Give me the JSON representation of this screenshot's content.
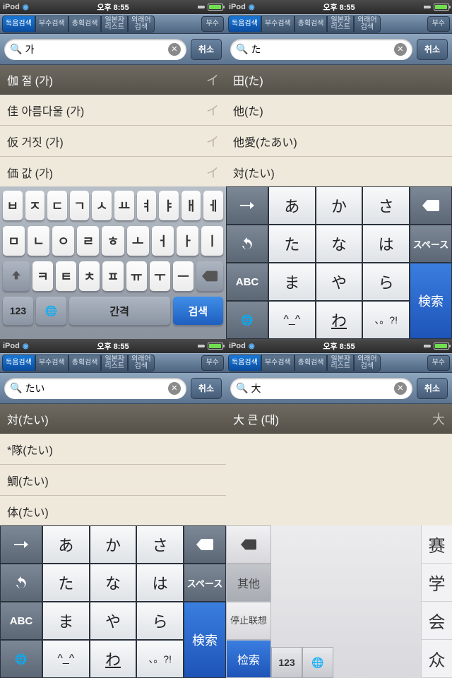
{
  "status": {
    "carrier": "iPod",
    "time": "오후 8:55"
  },
  "tabs": {
    "items": [
      "독음검색",
      "부수검색",
      "총획검색",
      "일본자\n리스트",
      "외래어\n검색"
    ],
    "extra": "부수"
  },
  "cancel": "취소",
  "screens": {
    "tl": {
      "query": "가",
      "header": {
        "text": "伽 절 (가)",
        "tail": "イ"
      },
      "rows": [
        {
          "text": "佳 아름다울 (가)",
          "tail": "イ"
        },
        {
          "text": "仮 거짓 (가)",
          "tail": "イ"
        },
        {
          "text": "価 값 (가)",
          "tail": "イ"
        }
      ]
    },
    "tr": {
      "query": "た",
      "header": {
        "text": "田(た)",
        "tail": ""
      },
      "rows": [
        {
          "text": "他(た)"
        },
        {
          "text": "他愛(たあい)"
        },
        {
          "text": "対(たい)"
        }
      ]
    },
    "bl": {
      "query": "たい",
      "header": {
        "text": "対(たい)",
        "tail": ""
      },
      "rows": [
        {
          "text": "*隊(たい)"
        },
        {
          "text": "鯛(たい)"
        },
        {
          "text": "体(たい)"
        }
      ]
    },
    "br": {
      "query": "大",
      "header": {
        "text": "大 큰 (대)",
        "tail": "大"
      },
      "rows": []
    }
  },
  "kb_ko": {
    "r1": [
      "ㅂ",
      "ㅈ",
      "ㄷ",
      "ㄱ",
      "ㅅ",
      "ㅛ",
      "ㅕ",
      "ㅑ",
      "ㅐ",
      "ㅔ"
    ],
    "r2": [
      "ㅁ",
      "ㄴ",
      "ㅇ",
      "ㄹ",
      "ㅎ",
      "ㅗ",
      "ㅓ",
      "ㅏ",
      "ㅣ"
    ],
    "r3": [
      "ㅋ",
      "ㅌ",
      "ㅊ",
      "ㅍ",
      "ㅠ",
      "ㅜ",
      "ㅡ"
    ],
    "num": "123",
    "space": "간격",
    "search": "검색"
  },
  "kb_jp": {
    "grid": [
      [
        "→",
        "あ",
        "か",
        "さ",
        "⌫"
      ],
      [
        "↺",
        "た",
        "な",
        "は",
        "スペース"
      ],
      [
        "ABC",
        "ま",
        "や",
        "ら",
        "検索"
      ],
      [
        "🌐",
        "゛゜",
        "わ",
        "、。?!",
        ""
      ]
    ],
    "sym_row4_c1": "^_^",
    "sym_row4_c3": "わ"
  },
  "cn": {
    "left": [
      "⌫",
      "其他",
      "停止联想",
      "检索"
    ],
    "bottom": [
      "123",
      "🌐"
    ],
    "cands": [
      "赛",
      "学",
      "会",
      "众"
    ]
  }
}
